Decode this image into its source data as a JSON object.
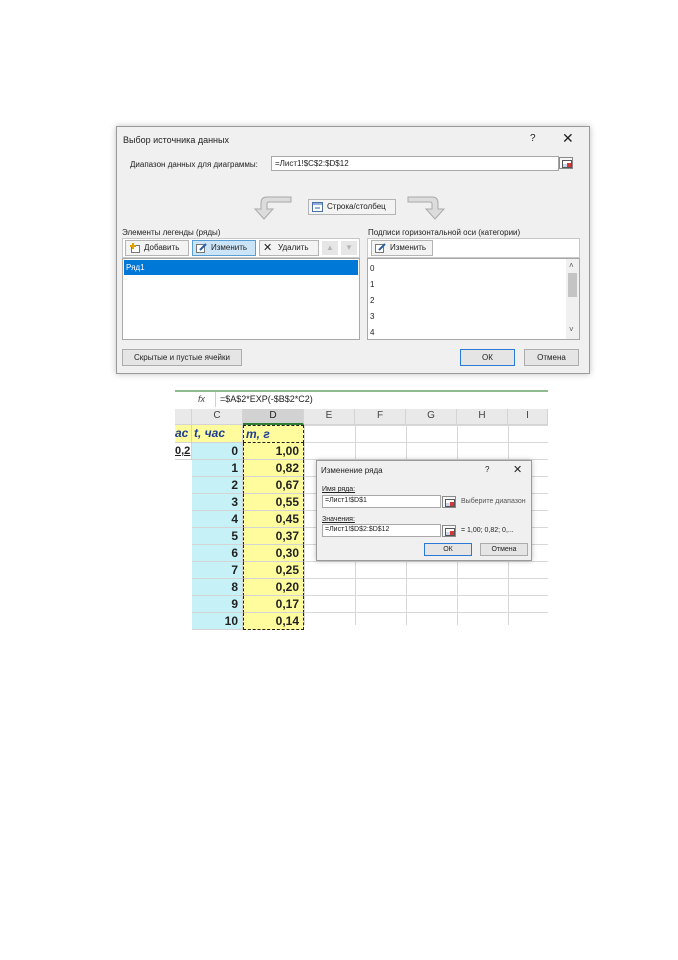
{
  "dialog_source": {
    "title": "Выбор источника данных",
    "help": "?",
    "close": "✕",
    "range_label": "Диапазон данных для диаграммы:",
    "range_value": "=Лист1!$C$2:$D$12",
    "switch_button": "Строка/столбец",
    "legend_label": "Элементы легенды (ряды)",
    "add_button": "Добавить",
    "edit_button": "Изменить",
    "delete_button": "Удалить",
    "series": [
      "Ряд1"
    ],
    "axis_label": "Подписи горизонтальной оси (категории)",
    "axis_edit_button": "Изменить",
    "categories": [
      "0",
      "1",
      "2",
      "3",
      "4"
    ],
    "hidden_cells_button": "Скрытые и пустые ячейки",
    "ok_button": "ОК",
    "cancel_button": "Отмена"
  },
  "sheet": {
    "fx_icon": "fx",
    "formula": "=$A$2*EXP(-$B$2*C2)",
    "columns": [
      "C",
      "D",
      "E",
      "F",
      "G",
      "H",
      "I"
    ],
    "header_b": "ас",
    "header_c": "t, час",
    "header_d": "m, г",
    "b_value": "0,2",
    "c_values": [
      "0",
      "1",
      "2",
      "3",
      "4",
      "5",
      "6",
      "7",
      "8",
      "9",
      "10"
    ],
    "d_values": [
      "1,00",
      "0,82",
      "0,67",
      "0,55",
      "0,45",
      "0,37",
      "0,30",
      "0,25",
      "0,20",
      "0,17",
      "0,14"
    ]
  },
  "dialog_series": {
    "title": "Изменение ряда",
    "help": "?",
    "close": "✕",
    "name_label": "Имя ряда:",
    "name_value": "=Лист1!$D$1",
    "name_hint": "Выберите диапазон",
    "values_label": "Значения:",
    "values_value": "=Лист1!$D$2:$D$12",
    "values_preview": "= 1,00; 0,82; 0,...",
    "ok_button": "ОК",
    "cancel_button": "Отмена"
  }
}
